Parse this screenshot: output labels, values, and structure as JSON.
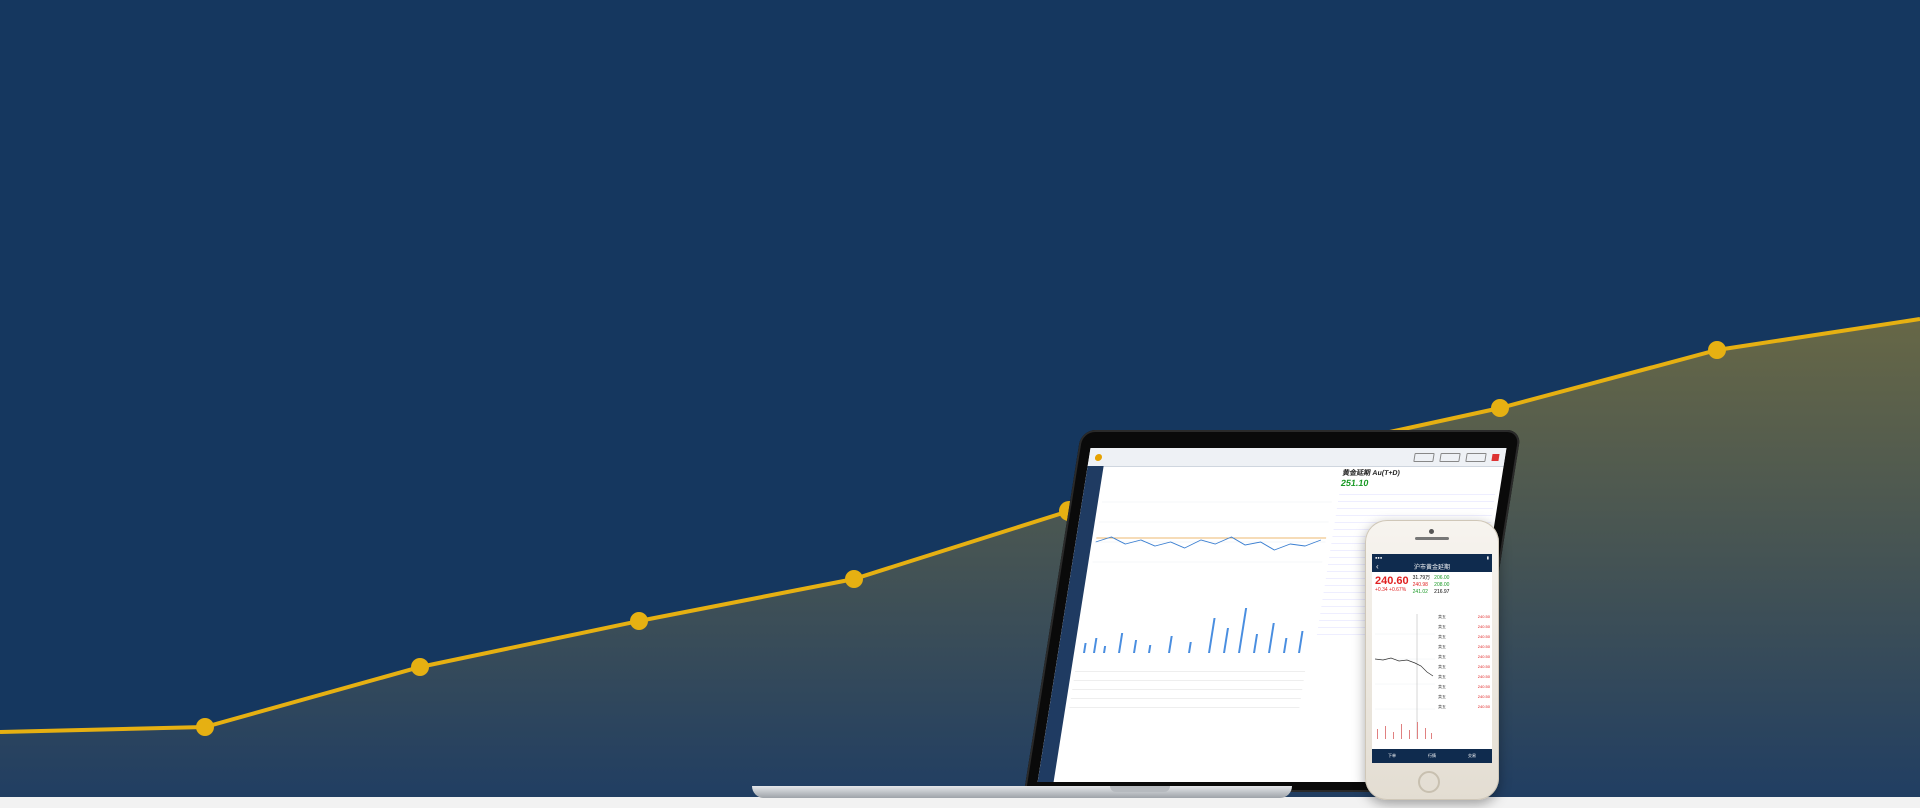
{
  "colors": {
    "background": "#15375f",
    "line": "#e6b012",
    "area_fill": "#6b6a45",
    "bottom_strip": "#f2f2f2"
  },
  "laptop": {
    "app_title": "",
    "quote_name": "黄金延期 Au(T+D)",
    "quote_price": "251.10"
  },
  "phone": {
    "nav_title": "沪市黄金延期",
    "price": "240.60",
    "change": "+0.34  +0.67%",
    "stat_1": "31.79万",
    "stat_2": "240.98",
    "stat_3": "241.02",
    "stat_4": "206.00",
    "stat_5": "208.00",
    "stat_6": "216.97",
    "order_label": "卖五",
    "order_price": "240.50",
    "tab_1": "下单",
    "tab_2": "行情",
    "tab_3": "交易"
  }
}
